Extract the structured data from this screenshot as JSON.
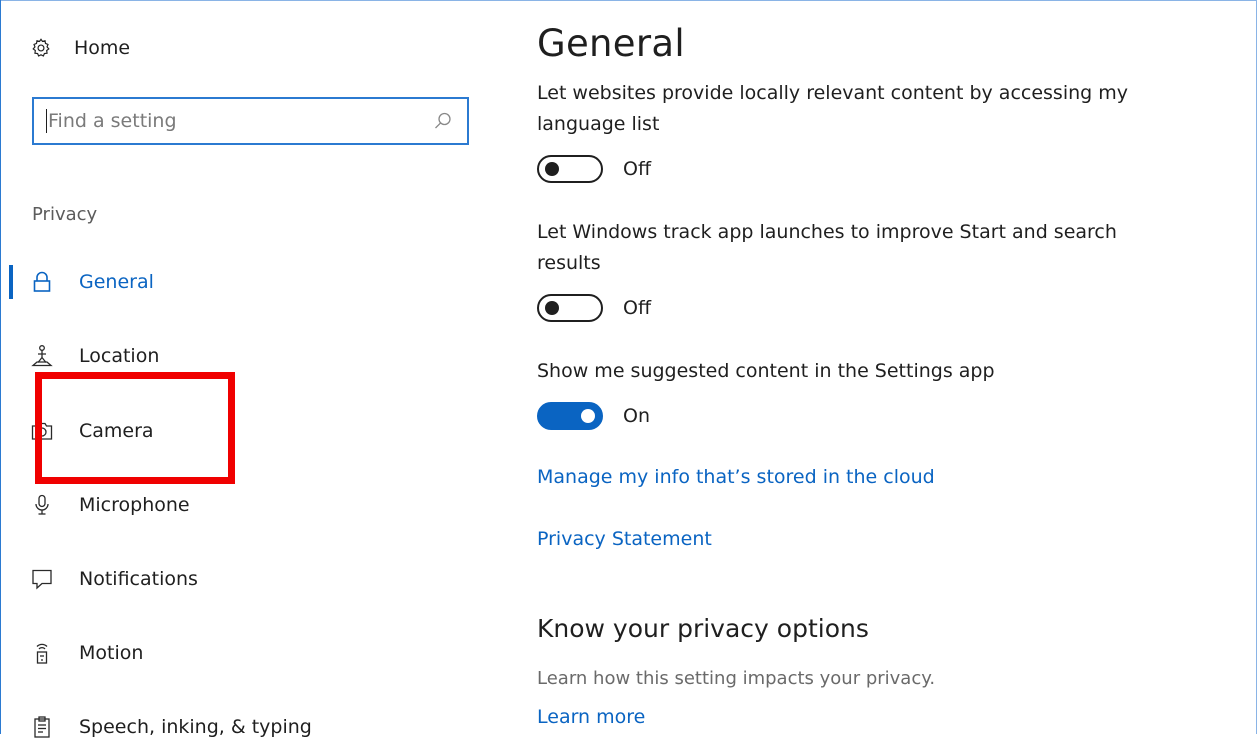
{
  "sidebar": {
    "home_label": "Home",
    "search": {
      "placeholder": "Find a setting",
      "value": ""
    },
    "section_label": "Privacy",
    "items": [
      {
        "label": "General",
        "icon": "lock-icon",
        "active": true
      },
      {
        "label": "Location",
        "icon": "location-person-icon"
      },
      {
        "label": "Camera",
        "icon": "camera-icon"
      },
      {
        "label": "Microphone",
        "icon": "microphone-icon"
      },
      {
        "label": "Notifications",
        "icon": "speech-bubble-icon"
      },
      {
        "label": "Motion",
        "icon": "motion-sensor-icon"
      },
      {
        "label": "Speech, inking, & typing",
        "icon": "clipboard-icon"
      }
    ]
  },
  "main": {
    "title": "General",
    "settings": [
      {
        "description": "Let websites provide locally relevant content by accessing my language list",
        "state": "Off"
      },
      {
        "description": "Let Windows track app launches to improve Start and search results",
        "state": "Off"
      },
      {
        "description": "Show me suggested content in the Settings app",
        "state": "On"
      }
    ],
    "links": {
      "manage_info": "Manage my info that’s stored in the cloud",
      "privacy_statement": "Privacy Statement"
    },
    "privacy_options": {
      "heading": "Know your privacy options",
      "subtext": "Learn how this setting impacts your privacy.",
      "learn_more": "Learn more"
    }
  },
  "colors": {
    "accent": "#0a64c2",
    "highlight": "#f00000",
    "search_border": "#2b7ad1"
  }
}
